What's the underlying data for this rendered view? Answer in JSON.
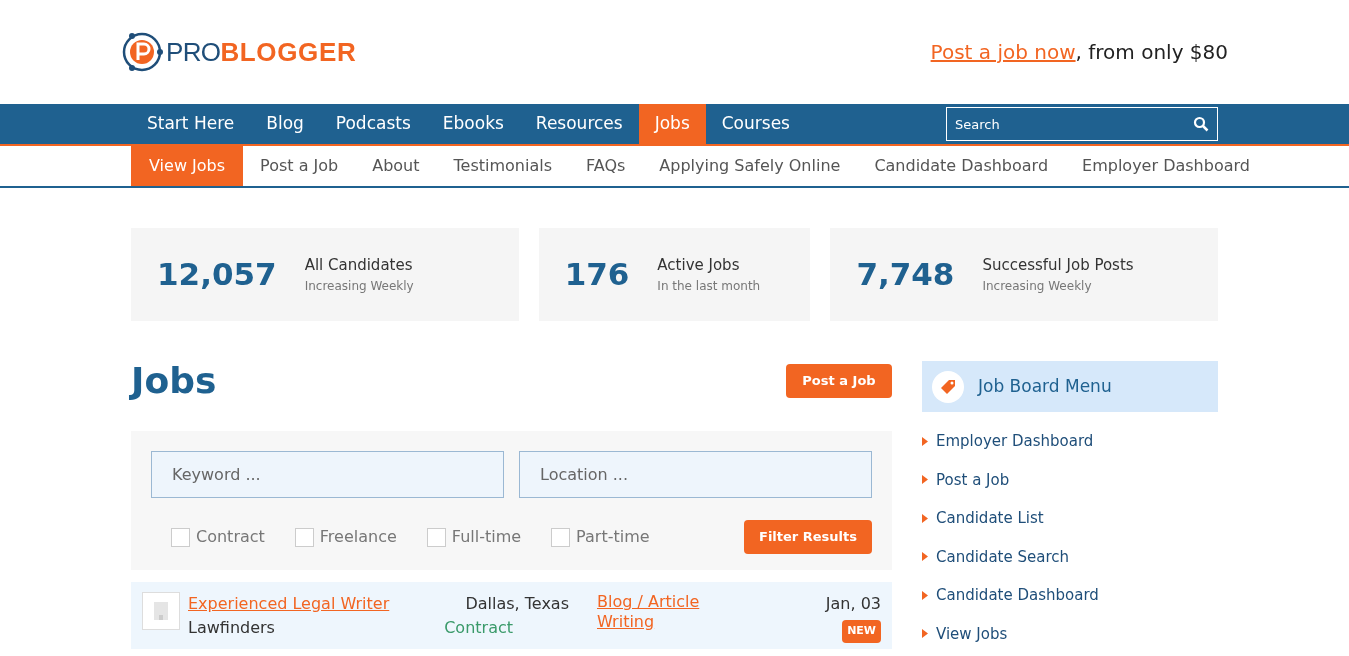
{
  "logo": {
    "part_1": "PRO",
    "part_2": "BLOGGER"
  },
  "header_cta": {
    "link": "Post a job now",
    "text": ", from only $80"
  },
  "main_nav": [
    {
      "label": "Start Here",
      "selected": false
    },
    {
      "label": "Blog",
      "selected": false
    },
    {
      "label": "Podcasts",
      "selected": false
    },
    {
      "label": "Ebooks",
      "selected": false
    },
    {
      "label": "Resources",
      "selected": false
    },
    {
      "label": "Jobs",
      "selected": true
    },
    {
      "label": "Courses",
      "selected": false
    }
  ],
  "search": {
    "placeholder": "Search"
  },
  "sub_nav": [
    {
      "label": "View Jobs",
      "selected": true
    },
    {
      "label": "Post a Job",
      "selected": false
    },
    {
      "label": "About",
      "selected": false
    },
    {
      "label": "Testimonials",
      "selected": false
    },
    {
      "label": "FAQs",
      "selected": false
    },
    {
      "label": "Applying Safely Online",
      "selected": false
    },
    {
      "label": "Candidate Dashboard",
      "selected": false
    },
    {
      "label": "Employer Dashboard",
      "selected": false
    }
  ],
  "stats": [
    {
      "number": "12,057",
      "label": "All Candidates",
      "sub": "Increasing Weekly"
    },
    {
      "number": "176",
      "label": "Active Jobs",
      "sub": "In the last month"
    },
    {
      "number": "7,748",
      "label": "Successful Job Posts",
      "sub": "Increasing Weekly"
    }
  ],
  "page_title": "Jobs",
  "post_button": "Post a Job",
  "filters": {
    "keyword_placeholder": "Keyword ...",
    "location_placeholder": "Location ...",
    "types": [
      {
        "label": "Contract",
        "checked": false
      },
      {
        "label": "Freelance",
        "checked": false
      },
      {
        "label": "Full-time",
        "checked": false
      },
      {
        "label": "Part-time",
        "checked": false
      }
    ],
    "button": "Filter Results"
  },
  "jobs": [
    {
      "title": "Experienced Legal Writer",
      "company": "Lawfinders",
      "location": "Dallas, Texas",
      "type": "Contract",
      "category": "Blog / Article Writing",
      "date": "Jan, 03",
      "badge": "NEW"
    }
  ],
  "sidebar": {
    "title": "Job Board Menu",
    "items": [
      "Employer Dashboard",
      "Post a Job",
      "Candidate List",
      "Candidate Search",
      "Candidate Dashboard",
      "View Jobs"
    ]
  }
}
